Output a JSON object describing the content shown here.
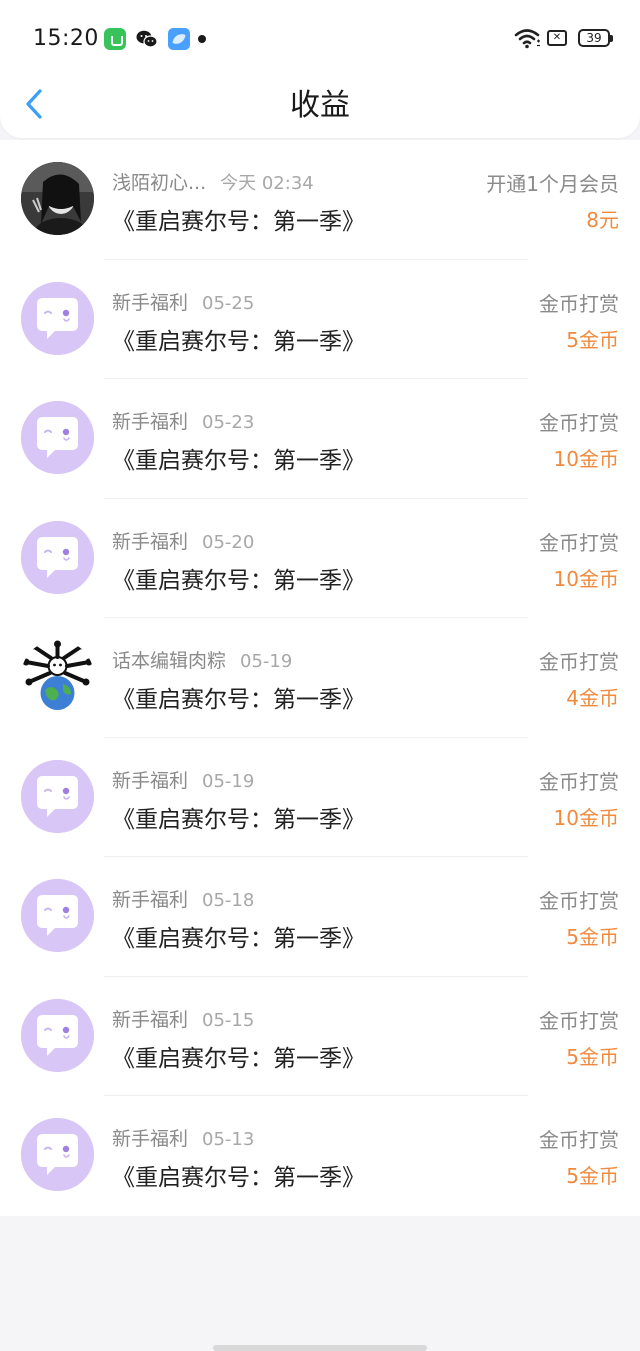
{
  "status_bar": {
    "time": "15:20",
    "battery": "39",
    "icons": [
      "app-store-icon",
      "wechat-icon",
      "browser-icon",
      "notification-dot-icon",
      "wifi-icon",
      "sim-off-icon",
      "battery-icon"
    ]
  },
  "header": {
    "title": "收益",
    "back_icon": "chevron-left-icon"
  },
  "colors": {
    "accent_back": "#3a9ff5",
    "amount": "#f08a3e",
    "avatar_placeholder": "#d8c6f6"
  },
  "items": [
    {
      "name": "浅陌初心...",
      "date": "今天 02:34",
      "book": "《重启赛尔号：第一季》",
      "type": "开通1个月会员",
      "amount": "8元",
      "avatar": "photo-avatar"
    },
    {
      "name": "新手福利",
      "date": "05-25",
      "book": "《重启赛尔号：第一季》",
      "type": "金币打赏",
      "amount": "5金币",
      "avatar": "chat-bubble-avatar"
    },
    {
      "name": "新手福利",
      "date": "05-23",
      "book": "《重启赛尔号：第一季》",
      "type": "金币打赏",
      "amount": "10金币",
      "avatar": "chat-bubble-avatar"
    },
    {
      "name": "新手福利",
      "date": "05-20",
      "book": "《重启赛尔号：第一季》",
      "type": "金币打赏",
      "amount": "10金币",
      "avatar": "chat-bubble-avatar"
    },
    {
      "name": "话本编辑肉粽",
      "date": "05-19",
      "book": "《重启赛尔号：第一季》",
      "type": "金币打赏",
      "amount": "4金币",
      "avatar": "globe-avatar"
    },
    {
      "name": "新手福利",
      "date": "05-19",
      "book": "《重启赛尔号：第一季》",
      "type": "金币打赏",
      "amount": "10金币",
      "avatar": "chat-bubble-avatar"
    },
    {
      "name": "新手福利",
      "date": "05-18",
      "book": "《重启赛尔号：第一季》",
      "type": "金币打赏",
      "amount": "5金币",
      "avatar": "chat-bubble-avatar"
    },
    {
      "name": "新手福利",
      "date": "05-15",
      "book": "《重启赛尔号：第一季》",
      "type": "金币打赏",
      "amount": "5金币",
      "avatar": "chat-bubble-avatar"
    },
    {
      "name": "新手福利",
      "date": "05-13",
      "book": "《重启赛尔号：第一季》",
      "type": "金币打赏",
      "amount": "5金币",
      "avatar": "chat-bubble-avatar"
    }
  ]
}
